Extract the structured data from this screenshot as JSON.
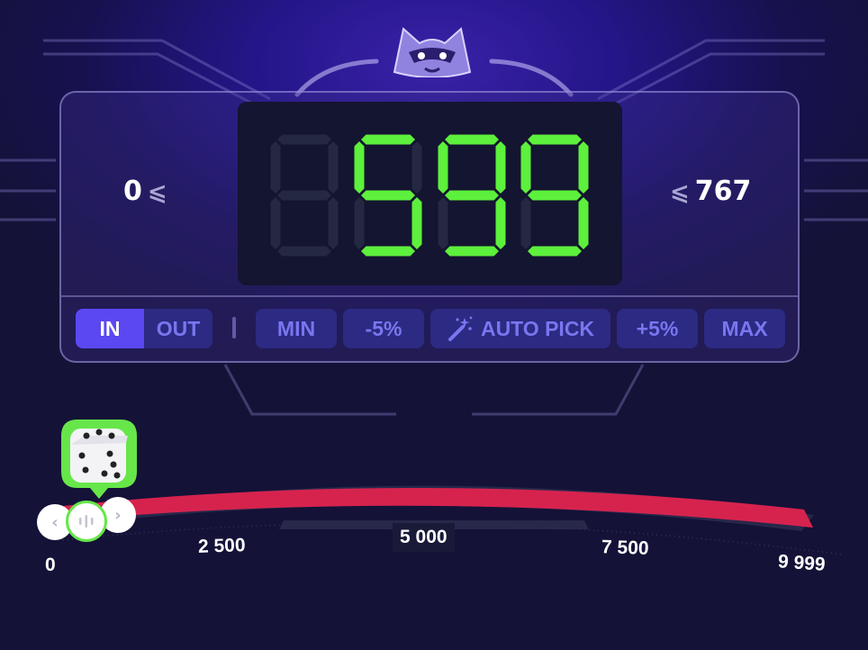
{
  "game": {
    "range_min": "0",
    "range_max": "767",
    "compare_symbol": "⩽",
    "display_value": "599",
    "display_digits": [
      "",
      "5",
      "9",
      "9"
    ],
    "digit_on_color": "#5df03c",
    "digit_off_color": "#252842"
  },
  "controls": {
    "in_label": "IN",
    "out_label": "OUT",
    "min_label": "MIN",
    "minus5_label": "-5%",
    "auto_pick_label": "AUTO PICK",
    "plus5_label": "+5%",
    "max_label": "MAX",
    "active_mode": "IN"
  },
  "slider": {
    "ticks": [
      "0",
      "2 500",
      "5 000",
      "7 500",
      "9 999"
    ],
    "value": 0,
    "bar_color": "#d6234e",
    "handle_accent": "#67e64a",
    "icons": [
      "mascot-icon",
      "dice-icon",
      "chevron-left-icon",
      "chevron-right-icon",
      "grip-icon",
      "magic-wand-icon"
    ]
  }
}
